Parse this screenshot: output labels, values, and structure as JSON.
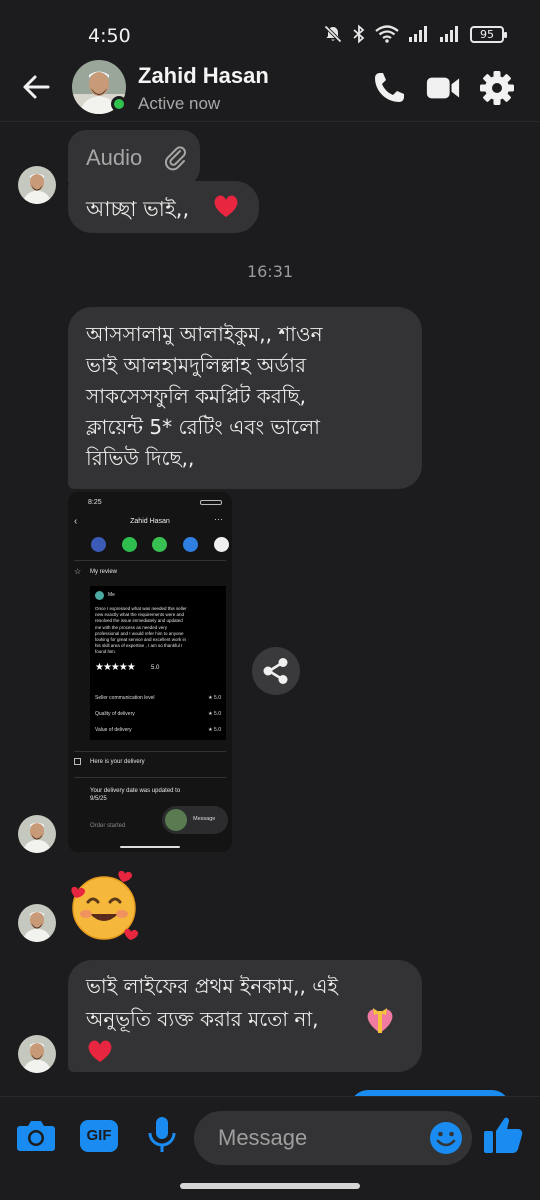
{
  "status_bar": {
    "time": "4:50",
    "battery": "95"
  },
  "header": {
    "name": "Zahid Hasan",
    "status": "Active now"
  },
  "messages": {
    "audio_label": "Audio",
    "msg1": "আচ্ছা ভাই,,",
    "timestamp": "16:31",
    "msg2_lines": [
      "আসসালামু আলাইকুম,, শাওন",
      "ভাই আলহামদুলিল্লাহ অর্ডার",
      "সাকসেসফুলি কমপ্লিট করছি,",
      "ক্লায়েন্ট 5* রেটিং এবং ভালো",
      "রিভিউ দিছে,,"
    ],
    "msg3_lines": [
      "ভাই লাইফের প্রথম ইনকাম,, এই",
      "অনুভূতি ব্যক্ত করার মতো না,"
    ]
  },
  "shared_screenshot": {
    "time": "8:25",
    "title": "Zahid Hasan",
    "my_review": "My review",
    "reviewer": "Me",
    "review_lines": [
      "Once I expressed what was needed this seller",
      "new exactly what the requirements were and",
      "resolved the issue immediately and updated",
      "me with the process as needed very",
      "professional and I would refer him to anyone",
      "looking for great service and excellent work in",
      "his skill area of expertise , I am so thankful I",
      "found him."
    ],
    "rating": "5.0",
    "criteria": [
      {
        "label": "Seller communication level",
        "score": "5.0"
      },
      {
        "label": "Quality of delivery",
        "score": "5.0"
      },
      {
        "label": "Value of delivery",
        "score": "5.0"
      }
    ],
    "delivery_label": "Here is your delivery",
    "delivery_date_lines": [
      "Your delivery date was updated to",
      "9/5/25"
    ],
    "order_started": "Order started",
    "message_btn": "Message"
  },
  "composer": {
    "placeholder": "Message",
    "gif_label": "GIF"
  },
  "colors": {
    "accent": "#1a8cf1",
    "bubble": "#333335",
    "background": "#1c1c1e",
    "online": "#31c24d",
    "heart": "#e8263f"
  }
}
